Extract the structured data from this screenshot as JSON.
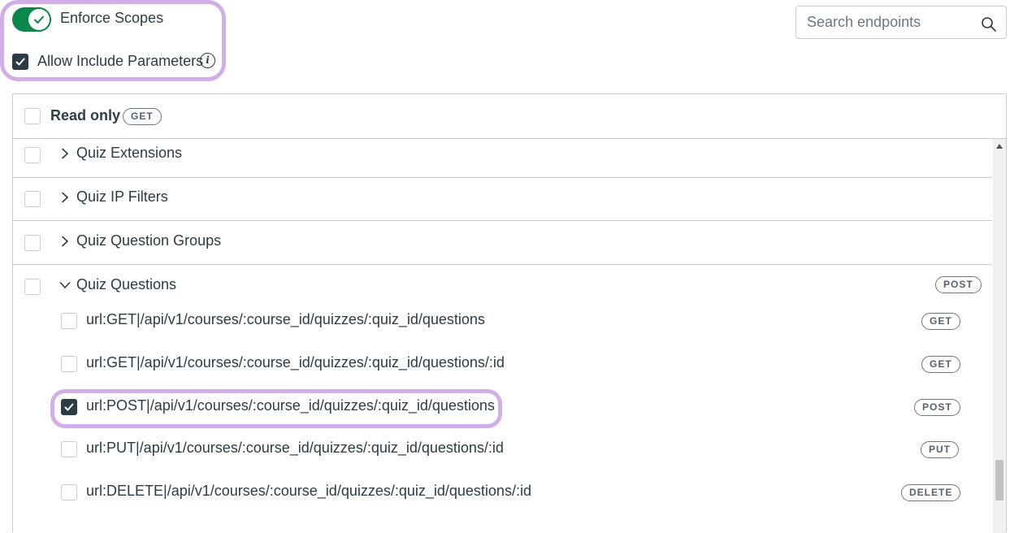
{
  "controls": {
    "enforce_scopes": {
      "label": "Enforce Scopes",
      "on": true
    },
    "allow_include": {
      "label": "Allow Include Parameters",
      "checked": true,
      "info_icon": "info-icon"
    }
  },
  "search": {
    "placeholder": "Search endpoints",
    "value": ""
  },
  "panel": {
    "header": {
      "label": "Read only",
      "badge": "GET"
    },
    "groups": [
      {
        "label": "Quiz Extensions",
        "expanded": false
      },
      {
        "label": "Quiz IP Filters",
        "expanded": false
      },
      {
        "label": "Quiz Question Groups",
        "expanded": false
      },
      {
        "label": "Quiz Questions",
        "expanded": true,
        "badge": "POST"
      }
    ],
    "endpoints": [
      {
        "label": "url:GET|/api/v1/courses/:course_id/quizzes/:quiz_id/questions",
        "method": "GET",
        "checked": false
      },
      {
        "label": "url:GET|/api/v1/courses/:course_id/quizzes/:quiz_id/questions/:id",
        "method": "GET",
        "checked": false
      },
      {
        "label": "url:POST|/api/v1/courses/:course_id/quizzes/:quiz_id/questions",
        "method": "POST",
        "checked": true
      },
      {
        "label": "url:PUT|/api/v1/courses/:course_id/quizzes/:quiz_id/questions/:id",
        "method": "PUT",
        "checked": false
      },
      {
        "label": "url:DELETE|/api/v1/courses/:course_id/quizzes/:quiz_id/questions/:id",
        "method": "DELETE",
        "checked": false
      }
    ]
  },
  "colors": {
    "toggle_on": "#0b874b",
    "checkbox_checked": "#2d3b45",
    "highlight": "#d1aee6",
    "border": "#c7cdd1"
  }
}
